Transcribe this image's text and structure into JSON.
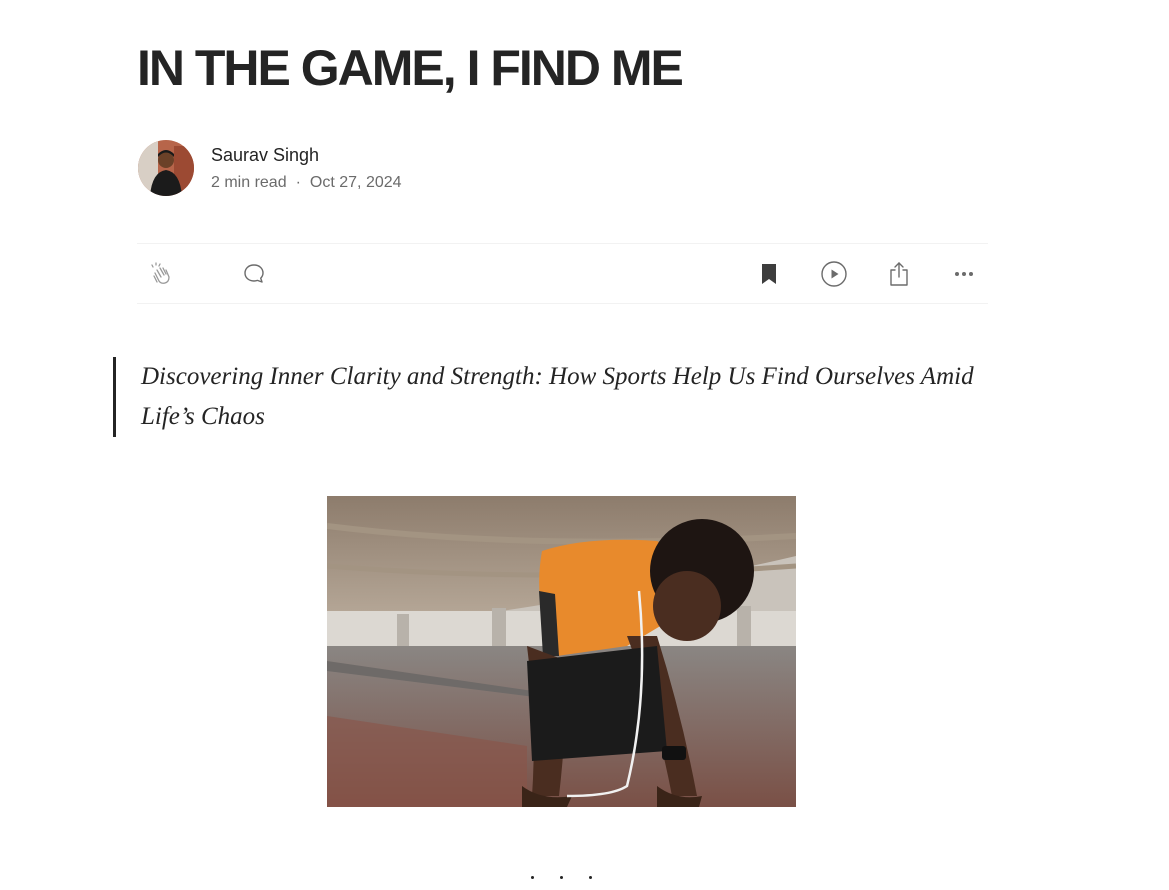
{
  "article": {
    "title": "IN THE GAME, I FIND ME",
    "subtitle": "Discovering Inner Clarity and Strength: How Sports Help Us Find Ourselves Amid Life’s Chaos"
  },
  "author": {
    "name": "Saurav Singh",
    "read_time": "2 min read",
    "separator": "·",
    "date": "Oct 27, 2024"
  },
  "actions": {
    "left": [
      {
        "icon": "clap-icon"
      },
      {
        "icon": "comment-icon"
      }
    ],
    "right": [
      {
        "icon": "bookmark-icon"
      },
      {
        "icon": "play-icon"
      },
      {
        "icon": "share-icon"
      },
      {
        "icon": "more-icon"
      }
    ]
  },
  "colors": {
    "text": "#242424",
    "muted": "#6b6b6b",
    "divider": "#f2f2f2",
    "icon": "#6b6b6b"
  }
}
